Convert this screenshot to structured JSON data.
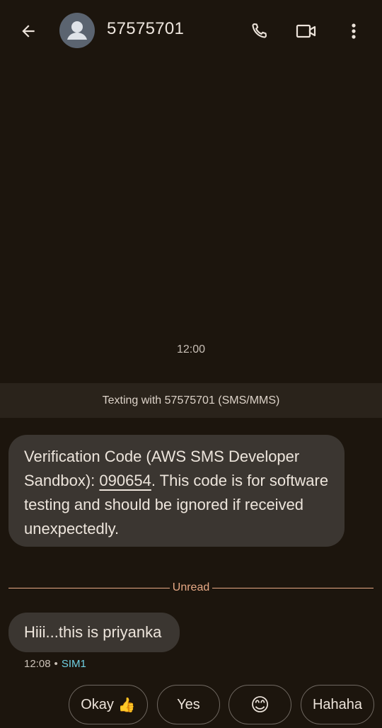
{
  "header": {
    "title": "57575701",
    "icons": [
      "back-arrow-icon",
      "contact-avatar-icon",
      "phone-icon",
      "video-call-icon",
      "more-vert-icon"
    ]
  },
  "conversation": {
    "time": "12:00",
    "info_banner": "Texting with 57575701 (SMS/MMS)",
    "message1": {
      "pre": "Verification Code (AWS SMS Developer Sandbox): ",
      "code": "090654",
      "post": ". This code is for software testing and should be ignored if received unexpectedly."
    },
    "unread_label": "Unread",
    "message2": "Hiii...this is priyanka",
    "message2_time": "12:08",
    "message2_sim": "SIM1"
  },
  "smart_replies": {
    "okay": "Okay",
    "okay_emoji": "👍",
    "yes": "Yes",
    "smile": "😊",
    "hahaha": "Hahaha"
  },
  "colors": {
    "background": "#1c150d",
    "bubble": "#3b3631",
    "unread_accent": "#e7a985",
    "sim_accent": "#6fd0e3"
  }
}
